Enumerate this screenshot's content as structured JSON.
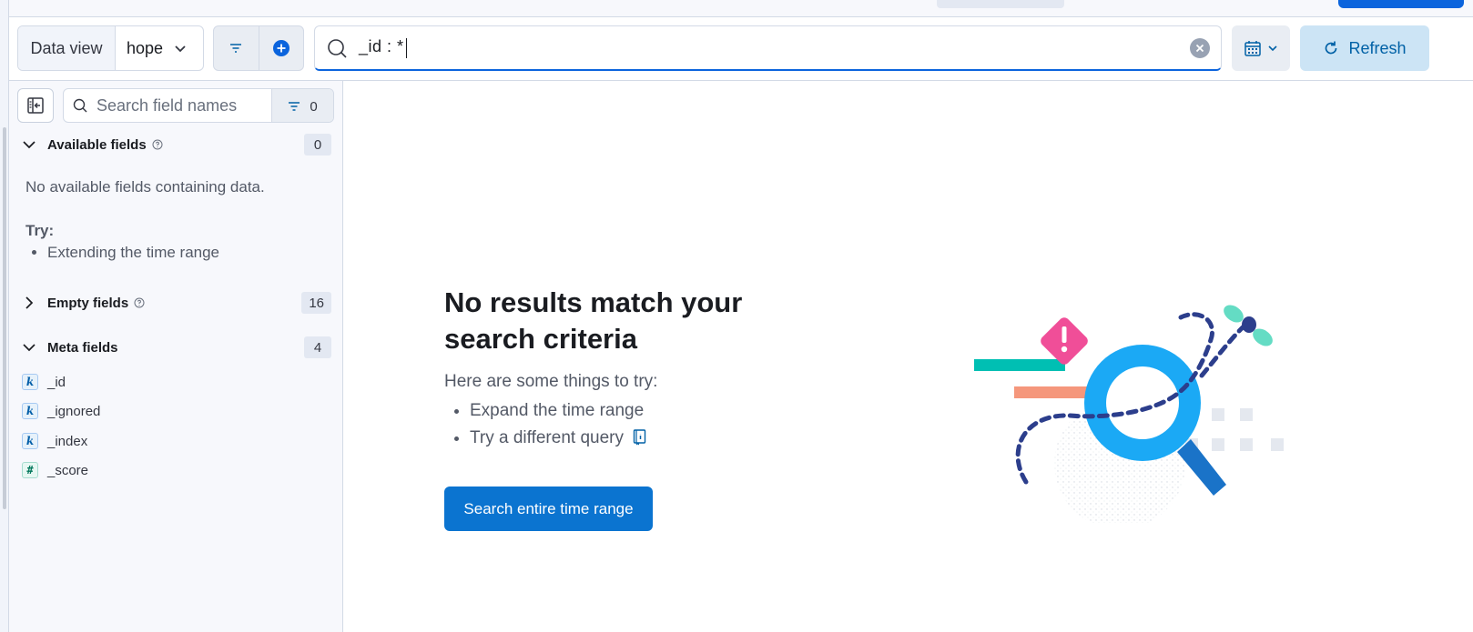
{
  "query_bar": {
    "data_view_label": "Data view",
    "data_view_value": "hope",
    "query_text": "_id : *",
    "refresh_label": "Refresh"
  },
  "sidebar": {
    "search_placeholder": "Search field names",
    "filter_count": "0",
    "available": {
      "title": "Available fields",
      "count": "0",
      "empty_message": "No available fields containing data.",
      "try_label": "Try:",
      "try_items": [
        "Extending the time range"
      ]
    },
    "empty": {
      "title": "Empty fields",
      "count": "16"
    },
    "meta": {
      "title": "Meta fields",
      "count": "4",
      "items": [
        {
          "type": "k",
          "name": "_id"
        },
        {
          "type": "k",
          "name": "_ignored"
        },
        {
          "type": "k",
          "name": "_index"
        },
        {
          "type": "#",
          "name": "_score"
        }
      ]
    }
  },
  "empty_state": {
    "title": "No results match your search criteria",
    "intro": "Here are some things to try:",
    "suggestions": [
      "Expand the time range",
      "Try a different query"
    ],
    "button_label": "Search entire time range"
  },
  "colors": {
    "accent": "#0b74d0",
    "refresh_bg": "#cce4f5",
    "magnifier": "#1ba9f5",
    "alert_pink": "#f04e98",
    "teal": "#00bfb3",
    "salmon": "#f5977c",
    "navy_dashes": "#2c3e8c"
  },
  "icons": [
    "menu-icon",
    "chevron-down-icon",
    "filter-icon",
    "plus-circle-icon",
    "search-icon",
    "clear-icon",
    "calendar-icon",
    "refresh-icon",
    "collapse-sidebar-icon",
    "info-icon",
    "chevron-right-icon",
    "documentation-icon"
  ]
}
